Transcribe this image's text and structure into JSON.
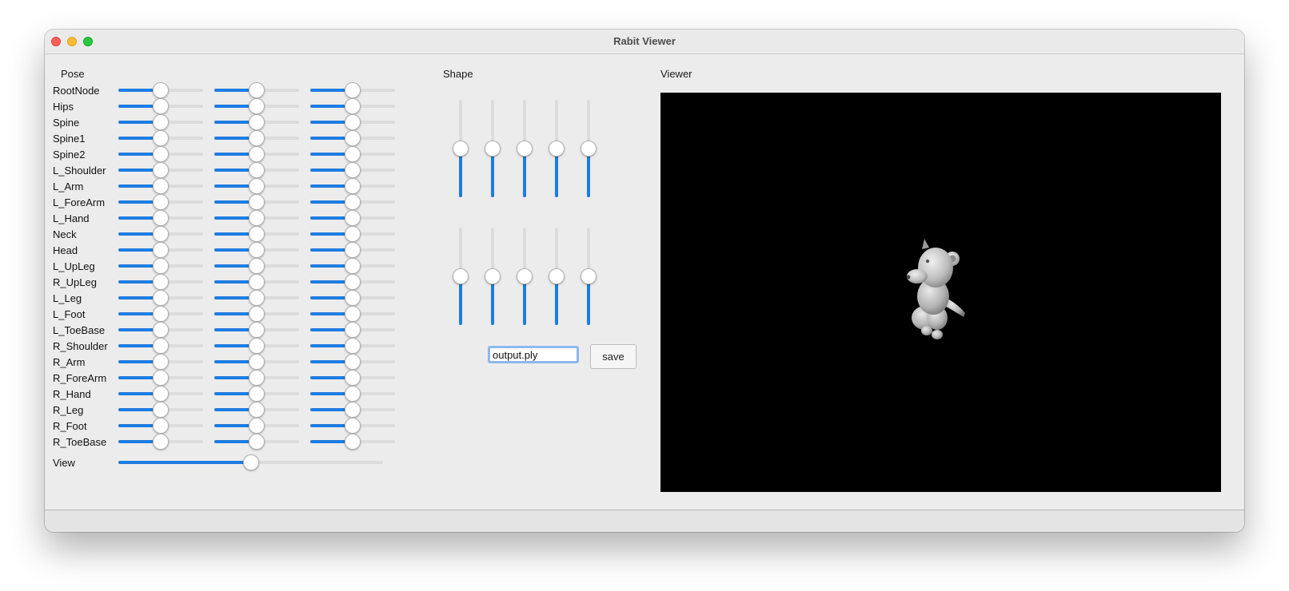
{
  "window": {
    "title": "Rabit Viewer"
  },
  "pose": {
    "heading": "Pose",
    "joints": [
      {
        "name": "RootNode",
        "values": [
          0.5,
          0.5,
          0.5
        ]
      },
      {
        "name": "Hips",
        "values": [
          0.5,
          0.5,
          0.5
        ]
      },
      {
        "name": "Spine",
        "values": [
          0.5,
          0.5,
          0.5
        ]
      },
      {
        "name": "Spine1",
        "values": [
          0.5,
          0.5,
          0.5
        ]
      },
      {
        "name": "Spine2",
        "values": [
          0.5,
          0.5,
          0.5
        ]
      },
      {
        "name": "L_Shoulder",
        "values": [
          0.5,
          0.5,
          0.5
        ]
      },
      {
        "name": "L_Arm",
        "values": [
          0.5,
          0.5,
          0.5
        ]
      },
      {
        "name": "L_ForeArm",
        "values": [
          0.5,
          0.5,
          0.5
        ]
      },
      {
        "name": "L_Hand",
        "values": [
          0.5,
          0.5,
          0.5
        ]
      },
      {
        "name": "Neck",
        "values": [
          0.5,
          0.5,
          0.5
        ]
      },
      {
        "name": "Head",
        "values": [
          0.5,
          0.5,
          0.5
        ]
      },
      {
        "name": "L_UpLeg",
        "values": [
          0.5,
          0.5,
          0.5
        ]
      },
      {
        "name": "R_UpLeg",
        "values": [
          0.5,
          0.5,
          0.5
        ]
      },
      {
        "name": "L_Leg",
        "values": [
          0.5,
          0.5,
          0.5
        ]
      },
      {
        "name": "L_Foot",
        "values": [
          0.5,
          0.5,
          0.5
        ]
      },
      {
        "name": "L_ToeBase",
        "values": [
          0.5,
          0.5,
          0.5
        ]
      },
      {
        "name": "R_Shoulder",
        "values": [
          0.5,
          0.5,
          0.5
        ]
      },
      {
        "name": "R_Arm",
        "values": [
          0.5,
          0.5,
          0.5
        ]
      },
      {
        "name": "R_ForeArm",
        "values": [
          0.5,
          0.5,
          0.5
        ]
      },
      {
        "name": "R_Hand",
        "values": [
          0.5,
          0.5,
          0.5
        ]
      },
      {
        "name": "R_Leg",
        "values": [
          0.5,
          0.5,
          0.5
        ]
      },
      {
        "name": "R_Foot",
        "values": [
          0.5,
          0.5,
          0.5
        ]
      },
      {
        "name": "R_ToeBase",
        "values": [
          0.5,
          0.5,
          0.5
        ]
      }
    ],
    "view_label": "View",
    "view_value": 0.5
  },
  "shape": {
    "heading": "Shape",
    "values": [
      0.5,
      0.5,
      0.5,
      0.5,
      0.5,
      0.5,
      0.5,
      0.5,
      0.5,
      0.5
    ]
  },
  "output": {
    "filename": "output.ply",
    "save_label": "save"
  },
  "viewer": {
    "heading": "Viewer",
    "background": "#000000",
    "model_icon": "bear-model-icon"
  },
  "colors": {
    "accent": "#1f7ce0",
    "groove": "#dcdcdc",
    "window_bg": "#ececec"
  }
}
